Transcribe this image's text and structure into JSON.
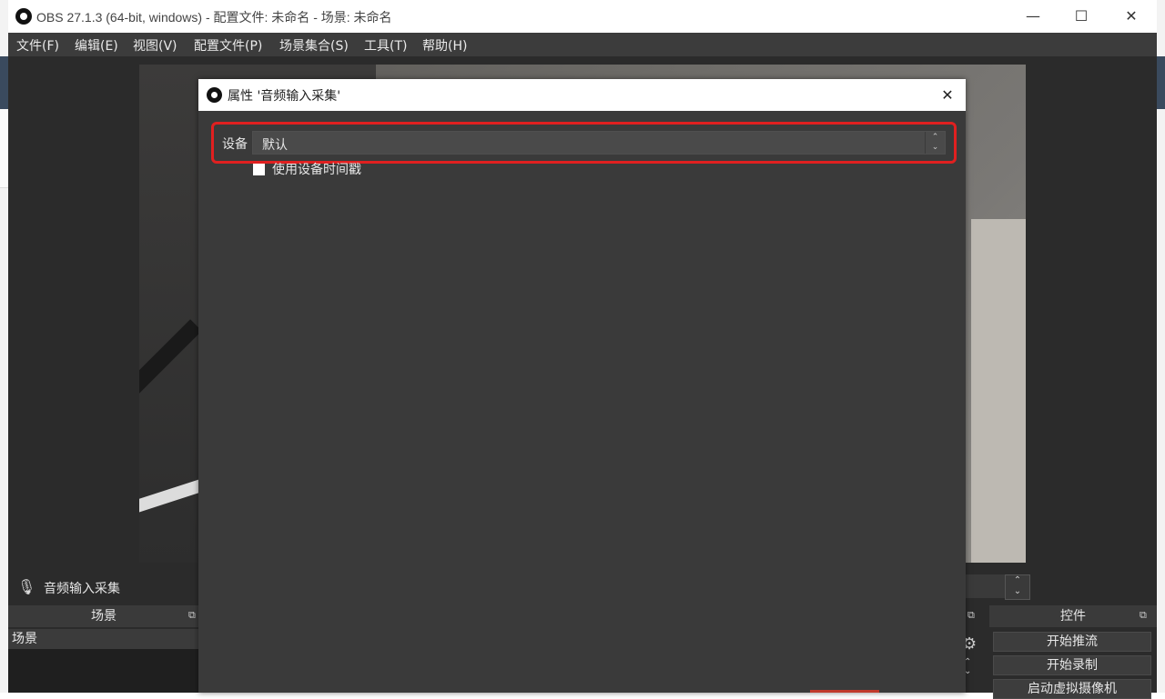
{
  "window": {
    "title": "OBS 27.1.3 (64-bit, windows) - 配置文件: 未命名 - 场景: 未命名",
    "minimize": "—",
    "maximize": "☐",
    "close": "✕"
  },
  "menu": [
    "文件(F)",
    "编辑(E)",
    "视图(V)",
    "配置文件(P)",
    "场景集合(S)",
    "工具(T)",
    "帮助(H)"
  ],
  "source_bar": {
    "source_name": "音频输入采集"
  },
  "docks": {
    "scenes_title": "场景",
    "scene_item": "场景",
    "controls_title": "控件",
    "controls": [
      "开始推流",
      "开始录制",
      "启动虚拟摄像机"
    ]
  },
  "dialog": {
    "title": "属性 '音频输入采集'",
    "close": "✕",
    "device_label": "设备",
    "device_value": "默认",
    "use_timestamps_label": "使用设备时间戳",
    "use_timestamps_checked": false
  },
  "icons": {
    "obs_logo": "obs-logo-icon",
    "mic": "microphone-icon",
    "gear": "gear-icon",
    "float": "float-dock-icon",
    "spin": "spin-arrows-icon"
  }
}
